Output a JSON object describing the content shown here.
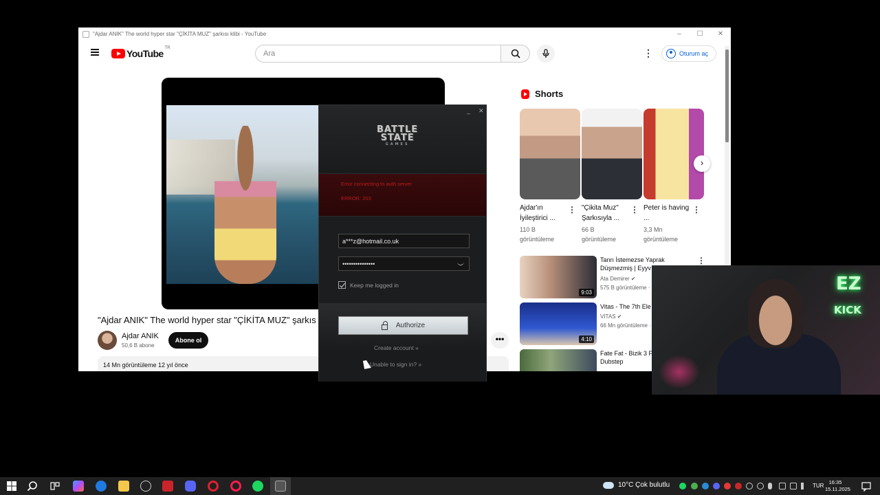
{
  "browser": {
    "window_title": "\"Ajdar ANIK\" The world hyper star \"ÇİKİTA MUZ\" şarkısı klibi - YouTube",
    "min_glyph": "–",
    "max_glyph": "☐",
    "close_glyph": "✕"
  },
  "youtube": {
    "logo_word": "YouTube",
    "logo_country": "TR",
    "search_placeholder": "Ara",
    "signin_label": "Oturum aç",
    "kebab_glyph": "⋮",
    "video_title": "\"Ajdar ANIK\" The world hyper star \"ÇİKİTA MUZ\" şarkıs",
    "channel_name": "Ajdar ANIK",
    "subscribers": "50,6 B abone",
    "subscribe_label": "Abone ol",
    "more_glyph": "•••",
    "description_meta": "14 Mn görüntüleme  12 yıl önce",
    "shorts_heading": "Shorts",
    "next_glyph": "›",
    "shorts": [
      {
        "title": "Ajdar'ın İyileştirici ...",
        "views_line1": "110 B",
        "views_line2": "görüntüleme"
      },
      {
        "title": "\"Çikita Muz\" Şarkısıyla ...",
        "views_line1": "66 B",
        "views_line2": "görüntüleme"
      },
      {
        "title": "Peter is having ...",
        "views_line1": "3,3 Mn",
        "views_line2": "görüntüleme"
      }
    ],
    "related": [
      {
        "title": "Tanrı İstemezse Yaprak Düşmezmiş | Eyyv",
        "channel": "Ata Demirer ✔",
        "meta": "575 B görüntüleme ·",
        "duration": "9:03"
      },
      {
        "title": "Vitas - The 7th Ele",
        "channel": "VITAS ✔",
        "meta": "66 Mn görüntüleme ·",
        "duration": "4:10"
      },
      {
        "title": "Fate Fat - Bizik 3 F DM) Dubstep",
        "channel": "",
        "meta": "",
        "duration": ""
      }
    ]
  },
  "launcher": {
    "logo_line1": "BATTLE",
    "logo_line2": "STATE",
    "logo_line3": "GAMES",
    "minimize_glyph": "_",
    "close_glyph": "✕",
    "error_message": "Error connecting to auth server",
    "error_code": "ERROR: 203",
    "email_value": "a***z@hotmail.co.uk",
    "password_value": "•••••••••••••••",
    "keep_logged_label": "Keep me logged in",
    "authorize_label": "Authorize",
    "create_account_label": "Create account  »",
    "unable_signin_label": "Unable to sign in?  »"
  },
  "webcam": {
    "neon_top": "EZ",
    "neon_bottom": "KICK"
  },
  "taskbar": {
    "weather_text": "10°C  Çok bulutlu",
    "language": "TUR",
    "time": "16:35",
    "date": "15.11.2025"
  },
  "colors": {
    "youtube_red": "#ff0000",
    "link_blue": "#065fd4",
    "error_red": "#b81b1b",
    "neon_green": "#3cff70"
  }
}
